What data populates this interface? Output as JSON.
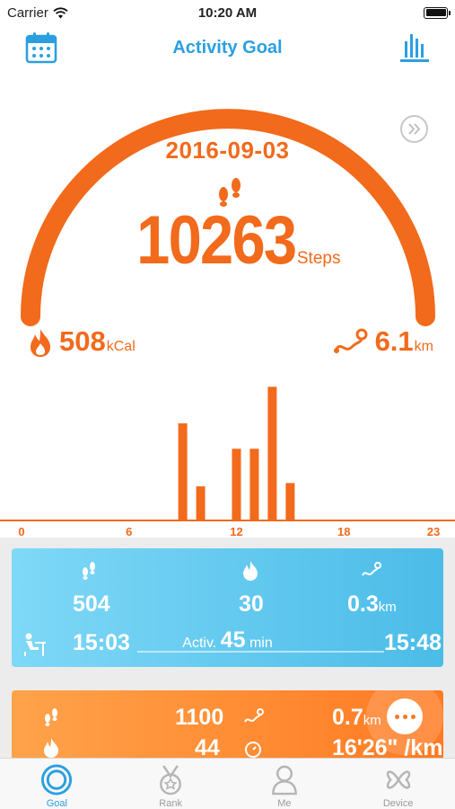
{
  "status_bar": {
    "carrier": "Carrier",
    "time": "10:20 AM",
    "battery_level": 1.0
  },
  "nav": {
    "title": "Activity Goal",
    "left_icon": "calendar-icon",
    "right_icon": "bar-chart-icon"
  },
  "summary": {
    "date": "2016-09-03",
    "steps": "10263",
    "steps_unit": "Steps",
    "calories": "508",
    "calories_unit": "kCal",
    "distance": "6.1",
    "distance_unit": "km",
    "goal_progress": 1.0
  },
  "colors": {
    "accent_orange": "#f26a1b",
    "accent_blue": "#2b9fe0",
    "card_blue": "#4bbce8",
    "card_orange": "#ff7a22"
  },
  "chart_data": {
    "type": "bar",
    "x": [
      9,
      10,
      12,
      13,
      14,
      15
    ],
    "values": [
      87,
      30,
      64,
      64,
      120,
      33
    ],
    "xlim": [
      0,
      23
    ],
    "xticks": [
      "0",
      "6",
      "12",
      "18",
      "23"
    ],
    "title": "",
    "xlabel": "",
    "ylabel": ""
  },
  "activities": [
    {
      "steps": "504",
      "calories": "30",
      "distance": "0.3",
      "distance_unit": "km",
      "start": "15:03",
      "end": "15:48",
      "activ_label": "Activ.",
      "activ_duration": "45",
      "activ_unit": "min"
    },
    {
      "steps": "1100",
      "distance": "0.7",
      "distance_unit": "km",
      "calories": "44",
      "pace": "16'26\" /km"
    }
  ],
  "tabs": [
    {
      "label": "Goal",
      "icon": "target-icon",
      "active": true
    },
    {
      "label": "Rank",
      "icon": "medal-icon",
      "active": false
    },
    {
      "label": "Me",
      "icon": "person-icon",
      "active": false
    },
    {
      "label": "Device",
      "icon": "device-icon",
      "active": false
    }
  ]
}
